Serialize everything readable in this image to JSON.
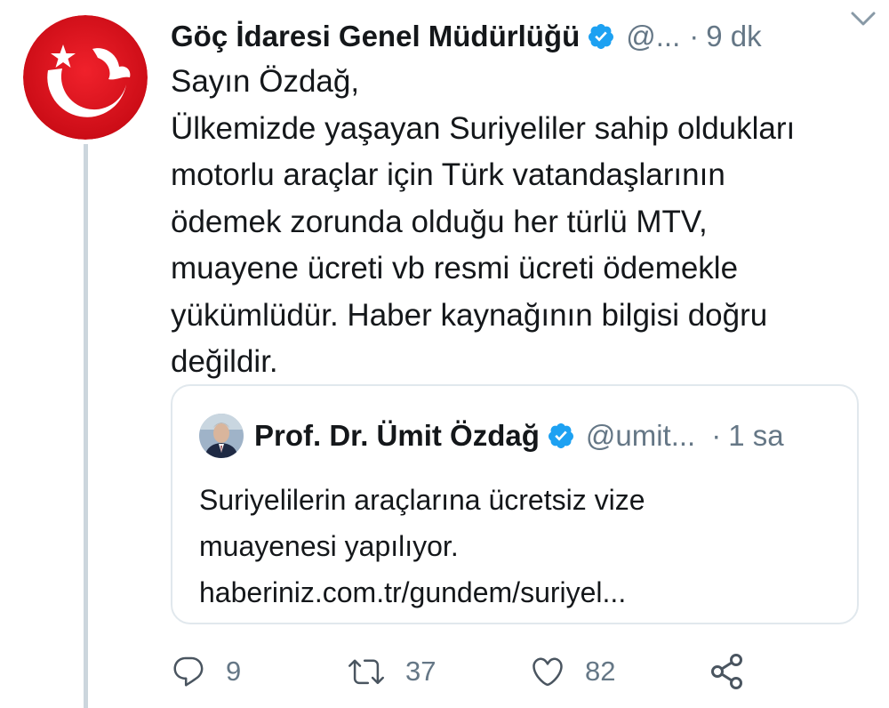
{
  "tweet": {
    "author_name": "Göç İdaresi Genel Müdürlüğü",
    "author_handle": "@...",
    "time_separator": "·",
    "time": "9 dk",
    "body_lines": [
      "Sayın Özdağ,",
      "Ülkemizde yaşayan Suriyeliler sahip oldukları",
      "motorlu araçlar için  Türk vatandaşlarının",
      "ödemek zorunda olduğu  her türlü MTV,",
      "muayene ücreti vb resmi ücreti ödemekle",
      "yükümlüdür. Haber kaynağının bilgisi doğru",
      "değildir."
    ]
  },
  "quoted": {
    "author_name": "Prof. Dr. Ümit Özdağ",
    "author_handle": "@umit...",
    "time_separator": "·",
    "time": "1 sa",
    "text_lines": [
      "Suriyelilerin araçlarına ücretsiz vize",
      "muayenesi yapılıyor.",
      "haberiniz.com.tr/gundem/suriyel..."
    ]
  },
  "actions": {
    "reply_count": "9",
    "retweet_count": "37",
    "like_count": "82"
  },
  "icons": {
    "verified": "verified-badge-icon",
    "more": "chevron-down-icon",
    "reply": "reply-icon",
    "retweet": "retweet-icon",
    "like": "heart-icon",
    "share": "share-icon"
  },
  "colors": {
    "verified_blue": "#1da1f2",
    "secondary_text": "#657786",
    "avatar_red": "#e30a17",
    "border": "#e1e8ed"
  }
}
